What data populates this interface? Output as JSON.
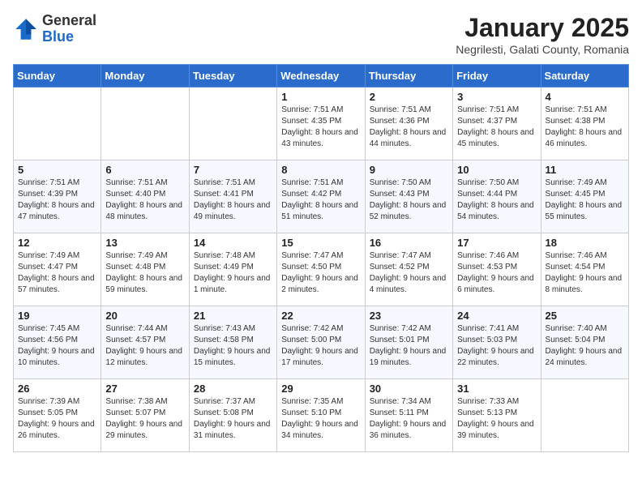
{
  "header": {
    "logo_general": "General",
    "logo_blue": "Blue",
    "title": "January 2025",
    "location": "Negrilesti, Galati County, Romania"
  },
  "weekdays": [
    "Sunday",
    "Monday",
    "Tuesday",
    "Wednesday",
    "Thursday",
    "Friday",
    "Saturday"
  ],
  "weeks": [
    [
      {
        "day": "",
        "info": ""
      },
      {
        "day": "",
        "info": ""
      },
      {
        "day": "",
        "info": ""
      },
      {
        "day": "1",
        "info": "Sunrise: 7:51 AM\nSunset: 4:35 PM\nDaylight: 8 hours and 43 minutes."
      },
      {
        "day": "2",
        "info": "Sunrise: 7:51 AM\nSunset: 4:36 PM\nDaylight: 8 hours and 44 minutes."
      },
      {
        "day": "3",
        "info": "Sunrise: 7:51 AM\nSunset: 4:37 PM\nDaylight: 8 hours and 45 minutes."
      },
      {
        "day": "4",
        "info": "Sunrise: 7:51 AM\nSunset: 4:38 PM\nDaylight: 8 hours and 46 minutes."
      }
    ],
    [
      {
        "day": "5",
        "info": "Sunrise: 7:51 AM\nSunset: 4:39 PM\nDaylight: 8 hours and 47 minutes."
      },
      {
        "day": "6",
        "info": "Sunrise: 7:51 AM\nSunset: 4:40 PM\nDaylight: 8 hours and 48 minutes."
      },
      {
        "day": "7",
        "info": "Sunrise: 7:51 AM\nSunset: 4:41 PM\nDaylight: 8 hours and 49 minutes."
      },
      {
        "day": "8",
        "info": "Sunrise: 7:51 AM\nSunset: 4:42 PM\nDaylight: 8 hours and 51 minutes."
      },
      {
        "day": "9",
        "info": "Sunrise: 7:50 AM\nSunset: 4:43 PM\nDaylight: 8 hours and 52 minutes."
      },
      {
        "day": "10",
        "info": "Sunrise: 7:50 AM\nSunset: 4:44 PM\nDaylight: 8 hours and 54 minutes."
      },
      {
        "day": "11",
        "info": "Sunrise: 7:49 AM\nSunset: 4:45 PM\nDaylight: 8 hours and 55 minutes."
      }
    ],
    [
      {
        "day": "12",
        "info": "Sunrise: 7:49 AM\nSunset: 4:47 PM\nDaylight: 8 hours and 57 minutes."
      },
      {
        "day": "13",
        "info": "Sunrise: 7:49 AM\nSunset: 4:48 PM\nDaylight: 8 hours and 59 minutes."
      },
      {
        "day": "14",
        "info": "Sunrise: 7:48 AM\nSunset: 4:49 PM\nDaylight: 9 hours and 1 minute."
      },
      {
        "day": "15",
        "info": "Sunrise: 7:47 AM\nSunset: 4:50 PM\nDaylight: 9 hours and 2 minutes."
      },
      {
        "day": "16",
        "info": "Sunrise: 7:47 AM\nSunset: 4:52 PM\nDaylight: 9 hours and 4 minutes."
      },
      {
        "day": "17",
        "info": "Sunrise: 7:46 AM\nSunset: 4:53 PM\nDaylight: 9 hours and 6 minutes."
      },
      {
        "day": "18",
        "info": "Sunrise: 7:46 AM\nSunset: 4:54 PM\nDaylight: 9 hours and 8 minutes."
      }
    ],
    [
      {
        "day": "19",
        "info": "Sunrise: 7:45 AM\nSunset: 4:56 PM\nDaylight: 9 hours and 10 minutes."
      },
      {
        "day": "20",
        "info": "Sunrise: 7:44 AM\nSunset: 4:57 PM\nDaylight: 9 hours and 12 minutes."
      },
      {
        "day": "21",
        "info": "Sunrise: 7:43 AM\nSunset: 4:58 PM\nDaylight: 9 hours and 15 minutes."
      },
      {
        "day": "22",
        "info": "Sunrise: 7:42 AM\nSunset: 5:00 PM\nDaylight: 9 hours and 17 minutes."
      },
      {
        "day": "23",
        "info": "Sunrise: 7:42 AM\nSunset: 5:01 PM\nDaylight: 9 hours and 19 minutes."
      },
      {
        "day": "24",
        "info": "Sunrise: 7:41 AM\nSunset: 5:03 PM\nDaylight: 9 hours and 22 minutes."
      },
      {
        "day": "25",
        "info": "Sunrise: 7:40 AM\nSunset: 5:04 PM\nDaylight: 9 hours and 24 minutes."
      }
    ],
    [
      {
        "day": "26",
        "info": "Sunrise: 7:39 AM\nSunset: 5:05 PM\nDaylight: 9 hours and 26 minutes."
      },
      {
        "day": "27",
        "info": "Sunrise: 7:38 AM\nSunset: 5:07 PM\nDaylight: 9 hours and 29 minutes."
      },
      {
        "day": "28",
        "info": "Sunrise: 7:37 AM\nSunset: 5:08 PM\nDaylight: 9 hours and 31 minutes."
      },
      {
        "day": "29",
        "info": "Sunrise: 7:35 AM\nSunset: 5:10 PM\nDaylight: 9 hours and 34 minutes."
      },
      {
        "day": "30",
        "info": "Sunrise: 7:34 AM\nSunset: 5:11 PM\nDaylight: 9 hours and 36 minutes."
      },
      {
        "day": "31",
        "info": "Sunrise: 7:33 AM\nSunset: 5:13 PM\nDaylight: 9 hours and 39 minutes."
      },
      {
        "day": "",
        "info": ""
      }
    ]
  ]
}
